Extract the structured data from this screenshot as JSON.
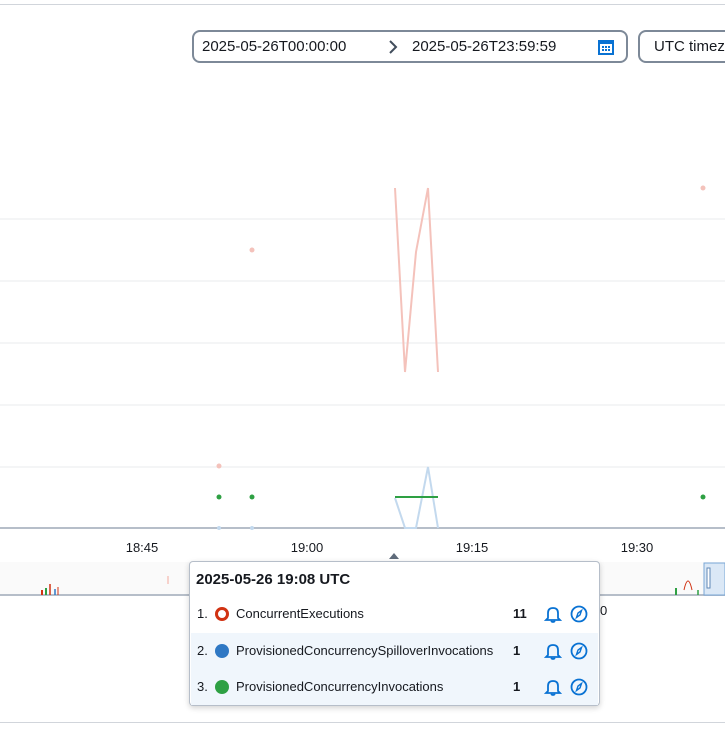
{
  "date_range": {
    "start": "2025-05-26T00:00:00",
    "end": "2025-05-26T23:59:59",
    "calendar_icon": "calendar-icon",
    "separator_icon": "chevron-right-icon"
  },
  "timezone": {
    "label": "UTC timez"
  },
  "x_ticks": [
    "18:45",
    "19:00",
    "19:15",
    "19:30"
  ],
  "behind_popover_text": "0",
  "tooltip": {
    "title": "2025-05-26 19:08 UTC",
    "rows": [
      {
        "index": "1.",
        "name": "ConcurrentExecutions",
        "value": "11",
        "color": "#d13212",
        "marker": "ring"
      },
      {
        "index": "2.",
        "name": "ProvisionedConcurrencySpilloverInvocations",
        "value": "1",
        "color": "#2f78c4",
        "marker": "dot"
      },
      {
        "index": "3.",
        "name": "ProvisionedConcurrencyInvocations",
        "value": "1",
        "color": "#2ea043",
        "marker": "dot"
      }
    ],
    "alarm_icon": "bell-icon",
    "explore_icon": "compass-icon"
  },
  "colors": {
    "accent": "#0972d3",
    "concurrent": "#d13212",
    "spillover": "#2f78c4",
    "provisioned": "#2ea043",
    "gridline": "#e9ebed"
  }
}
